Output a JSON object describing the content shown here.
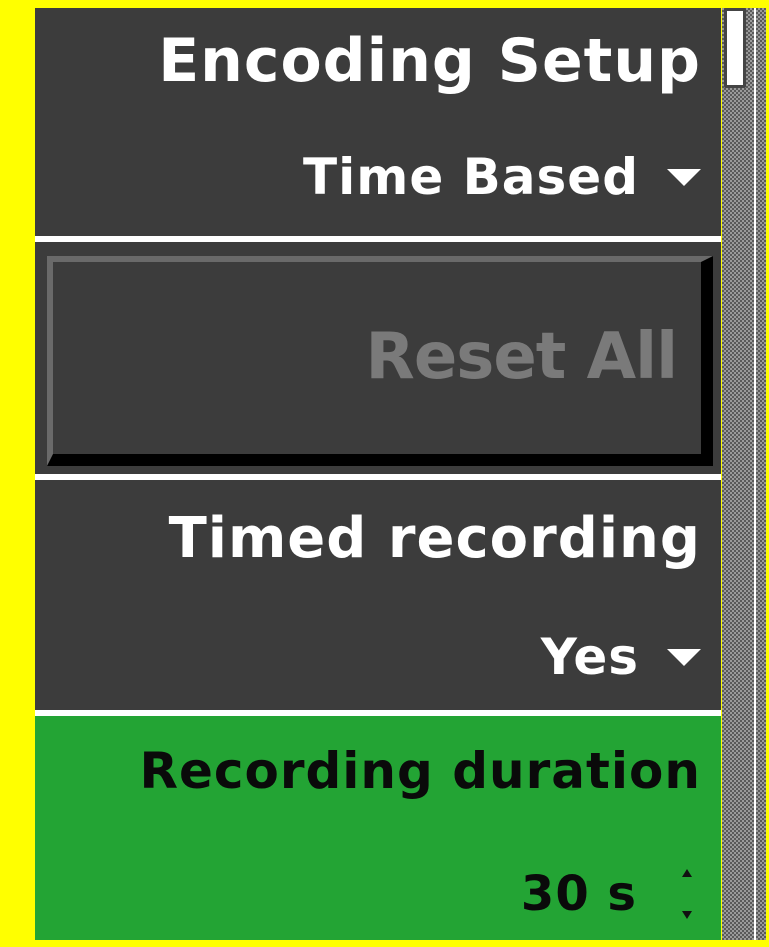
{
  "panel": {
    "encoding_setup": {
      "title": "Encoding Setup",
      "value": "Time Based"
    },
    "reset_button": {
      "label": "Reset All",
      "enabled": false
    },
    "timed_recording": {
      "title": "Timed recording",
      "value": "Yes"
    },
    "recording_duration": {
      "title": "Recording duration",
      "value": "30 s",
      "highlighted": true
    }
  },
  "icons": {
    "dropdown": "chevron-down-icon",
    "spinner": "up-down-spinner-icon"
  },
  "colors": {
    "background_frame": "#ffff00",
    "panel_background": "#3c3c3c",
    "highlight_green": "#23a434",
    "disabled_text": "#7a7a7a",
    "separator": "#ffffff"
  }
}
